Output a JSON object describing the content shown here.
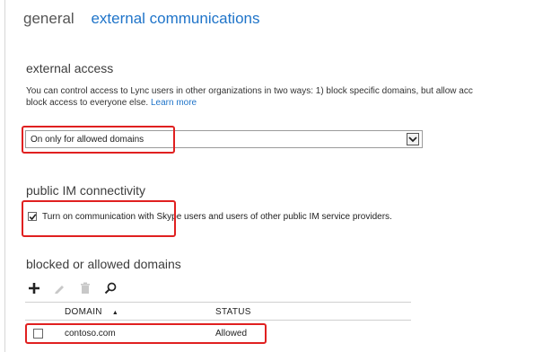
{
  "tabs": [
    {
      "label": "general",
      "active": false
    },
    {
      "label": "external communications",
      "active": true
    }
  ],
  "external_access": {
    "title": "external access",
    "description": "You can control access to Lync users in other organizations in two ways: 1) block specific domains, but allow acc",
    "description_line2": "block access to everyone else.",
    "learn_more": "Learn more",
    "dropdown_value": "On only for allowed domains"
  },
  "public_im": {
    "title": "public IM connectivity",
    "checkbox_label": "Turn on communication with Skype users and users of other public IM service providers.",
    "checked": true
  },
  "domains": {
    "title": "blocked or allowed domains",
    "toolbar": {
      "add_icon": "plus-icon",
      "edit_icon": "pencil-icon",
      "delete_icon": "trash-icon",
      "search_icon": "search-icon"
    },
    "columns": {
      "domain": "DOMAIN",
      "sort_indicator": "▲",
      "status": "STATUS"
    },
    "rows": [
      {
        "domain": "contoso.com",
        "status": "Allowed"
      }
    ]
  },
  "colors": {
    "accent": "#1f74c9",
    "highlight": "#e02020"
  }
}
